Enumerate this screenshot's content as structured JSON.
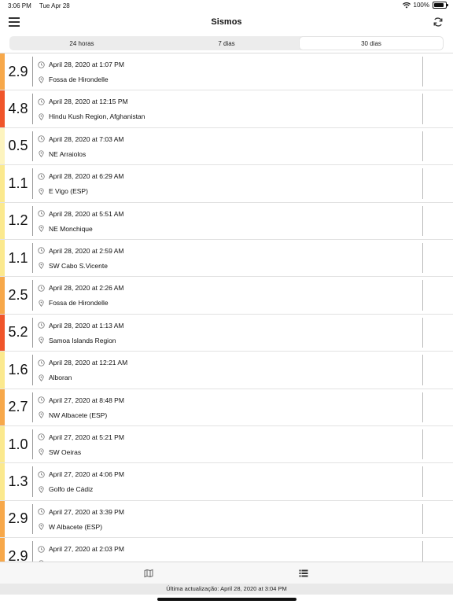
{
  "status_bar": {
    "time": "3:06 PM",
    "date": "Tue Apr 28",
    "battery": "100%",
    "battery_fraction": 1.0
  },
  "nav": {
    "title": "Sismos"
  },
  "segments": [
    {
      "label": "24 horas",
      "active": false
    },
    {
      "label": "7 dias",
      "active": false
    },
    {
      "label": "30 dias",
      "active": true
    }
  ],
  "colors": {
    "red": "#f0552a",
    "orange": "#f7a84a",
    "yellow": "#fbe98e",
    "pale": "#fdf4bf"
  },
  "quakes": [
    {
      "magnitude": "2.9",
      "datetime": "April 28, 2020 at 1:07 PM",
      "location": "Fossa de Hirondelle",
      "level": "orange"
    },
    {
      "magnitude": "4.8",
      "datetime": "April 28, 2020 at 12:15 PM",
      "location": "Hindu Kush Region, Afghanistan",
      "level": "red"
    },
    {
      "magnitude": "0.5",
      "datetime": "April 28, 2020 at 7:03 AM",
      "location": "NE Arraiolos",
      "level": "pale"
    },
    {
      "magnitude": "1.1",
      "datetime": "April 28, 2020 at 6:29 AM",
      "location": "E  Vigo (ESP)",
      "level": "yellow"
    },
    {
      "magnitude": "1.2",
      "datetime": "April 28, 2020 at 5:51 AM",
      "location": "NE Monchique",
      "level": "yellow"
    },
    {
      "magnitude": "1.1",
      "datetime": "April 28, 2020 at 2:59 AM",
      "location": "SW Cabo S.Vicente",
      "level": "yellow"
    },
    {
      "magnitude": "2.5",
      "datetime": "April 28, 2020 at 2:26 AM",
      "location": "Fossa de Hirondelle",
      "level": "orange"
    },
    {
      "magnitude": "5.2",
      "datetime": "April 28, 2020 at 1:13 AM",
      "location": "Samoa Islands Region",
      "level": "red"
    },
    {
      "magnitude": "1.6",
      "datetime": "April 28, 2020 at 12:21 AM",
      "location": "Alboran",
      "level": "yellow"
    },
    {
      "magnitude": "2.7",
      "datetime": "April 27, 2020 at 8:48 PM",
      "location": "NW Albacete (ESP)",
      "level": "orange"
    },
    {
      "magnitude": "1.0",
      "datetime": "April 27, 2020 at 5:21 PM",
      "location": "SW Oeiras",
      "level": "yellow"
    },
    {
      "magnitude": "1.3",
      "datetime": "April 27, 2020 at 4:06 PM",
      "location": "Golfo de Cádiz",
      "level": "yellow"
    },
    {
      "magnitude": "2.9",
      "datetime": "April 27, 2020 at 3:39 PM",
      "location": "W  Albacete (ESP)",
      "level": "orange"
    },
    {
      "magnitude": "2.9",
      "datetime": "April 27, 2020 at 2:03 PM",
      "location": "",
      "level": "orange"
    }
  ],
  "footer": {
    "text": "Última actualização: April 28, 2020 at 3:04 PM"
  },
  "icons": {
    "time": "clock-icon",
    "place": "location-pin-icon",
    "menu": "hamburger-menu-icon",
    "refresh": "refresh-icon",
    "map": "map-icon",
    "list": "list-icon",
    "wifi": "wifi-icon"
  }
}
